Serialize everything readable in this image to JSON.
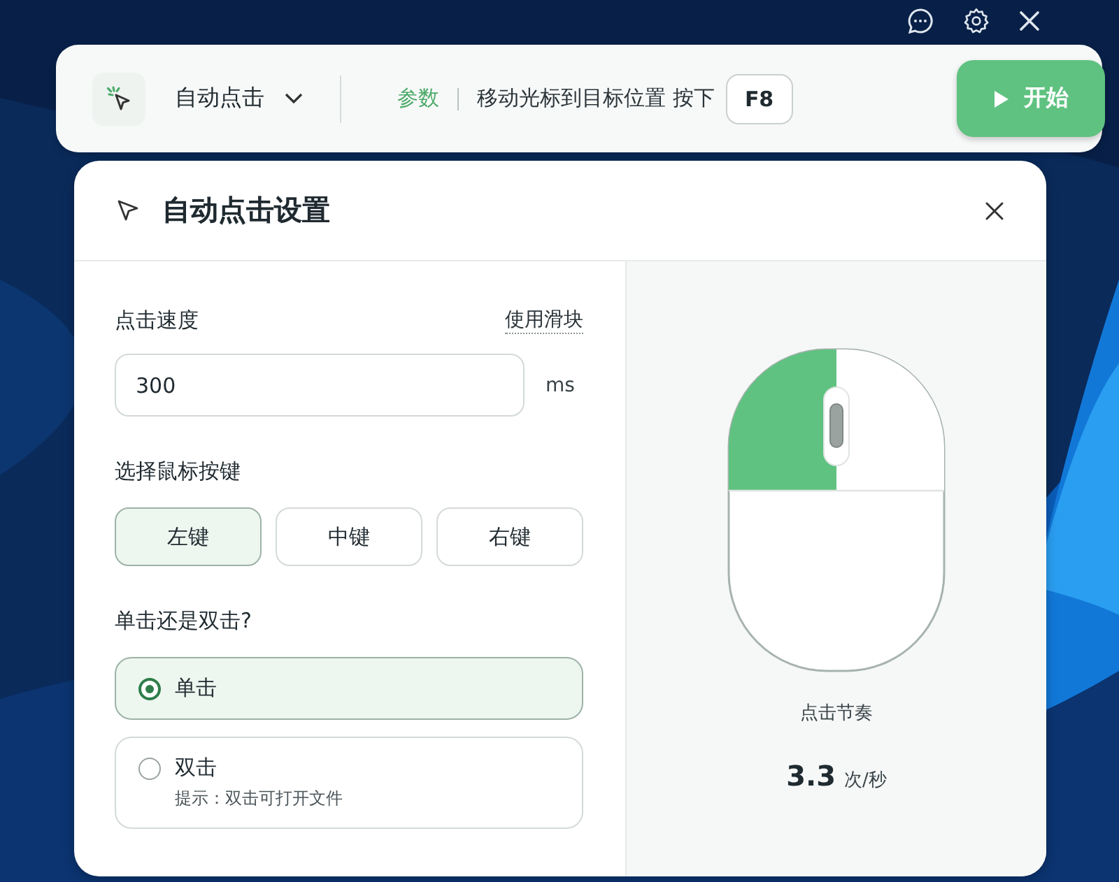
{
  "toolbar": {
    "mode": "自动点击",
    "params_label": "参数",
    "instruction": "移动光标到目标位置 按下",
    "hotkey": "F8",
    "start_button": "开始"
  },
  "panel": {
    "title": "自动点击设置",
    "speed": {
      "label": "点击速度",
      "toggle_link": "使用滑块",
      "value": "300",
      "unit": "ms"
    },
    "mouse_button": {
      "label": "选择鼠标按键",
      "options": [
        {
          "label": "左键",
          "selected": true
        },
        {
          "label": "中键",
          "selected": false
        },
        {
          "label": "右键",
          "selected": false
        }
      ]
    },
    "click_type": {
      "label": "单击还是双击?",
      "options": [
        {
          "label": "单击",
          "selected": true
        },
        {
          "label": "双击",
          "selected": false,
          "hint": "提示：双击可打开文件"
        }
      ]
    },
    "preview": {
      "label": "点击节奏",
      "rate": "3.3",
      "rate_unit": "次/秒"
    }
  }
}
